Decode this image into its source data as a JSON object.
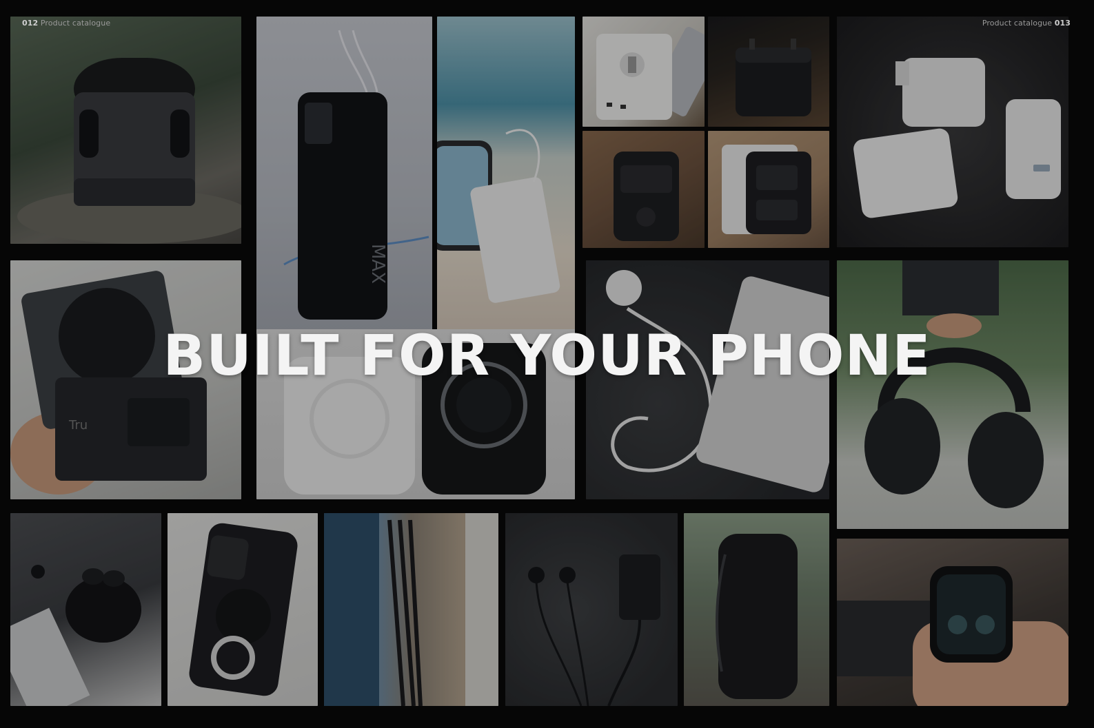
{
  "folio_left": {
    "page_number": "012",
    "label": "Product catalogue"
  },
  "folio_right": {
    "label": "Product catalogue",
    "page_number": "013"
  },
  "headline": "BUILT FOR YOUR PHONE",
  "photos": [
    {
      "icon": "speaker-icon"
    },
    {
      "icon": "power-bank-icon"
    },
    {
      "icon": "power-bank-on-beach-icon"
    },
    {
      "icon": "travel-adapter-icon"
    },
    {
      "icon": "travel-adapter-cube-icon"
    },
    {
      "icon": "wall-charger-icon"
    },
    {
      "icon": "travel-adapter-black-icon"
    },
    {
      "icon": "adapter-in-socket-icon"
    },
    {
      "icon": "wireless-charging-cube-icon"
    },
    {
      "icon": "magsafe-power-bank-icon"
    },
    {
      "icon": "watch-charger-cable-icon"
    },
    {
      "icon": "headphones-icon"
    },
    {
      "icon": "earbuds-icon"
    },
    {
      "icon": "phone-case-icon"
    },
    {
      "icon": "usb-cable-icon"
    },
    {
      "icon": "earphones-and-charger-icon"
    },
    {
      "icon": "portable-speaker-icon"
    },
    {
      "icon": "smartwatch-icon"
    }
  ]
}
